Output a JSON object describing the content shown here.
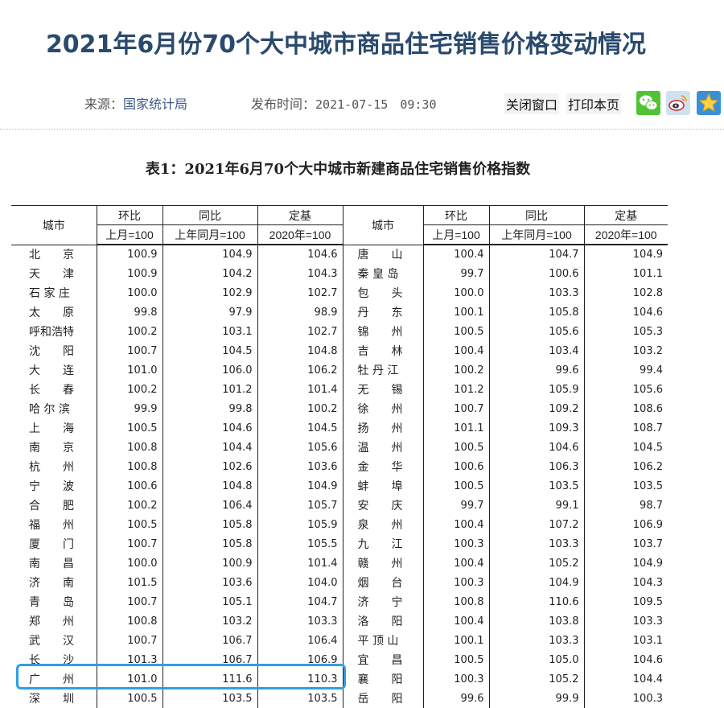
{
  "page": {
    "title": "2021年6月份70个大中城市商品住宅销售价格变动情况",
    "source_label": "来源：",
    "source_value": "国家统计局",
    "time_label": "发布时间：",
    "time_value": "2021-07-15　09:30",
    "close_window": "关闭窗口",
    "print_page": "打印本页",
    "share_icons": [
      "wechat-icon",
      "weibo-icon",
      "favorite-star-icon"
    ],
    "highlight_color": "#2e9fe8"
  },
  "table": {
    "caption": "表1：2021年6月70个大中城市新建商品住宅销售价格指数",
    "headers": {
      "city": "城市",
      "mom": "环比",
      "yoy": "同比",
      "base": "定基",
      "mom_base": "上月=100",
      "yoy_base": "上年同月=100",
      "base_base": "2020年=100"
    },
    "rows": [
      {
        "c1": "北　　京",
        "m1": "100.9",
        "y1": "104.9",
        "b1": "104.6",
        "c2": "唐　　山",
        "m2": "100.4",
        "y2": "104.7",
        "b2": "104.9"
      },
      {
        "c1": "天　　津",
        "m1": "100.9",
        "y1": "104.2",
        "b1": "104.3",
        "c2": "秦 皇 岛",
        "m2": "99.7",
        "y2": "100.6",
        "b2": "101.1"
      },
      {
        "c1": "石 家 庄",
        "m1": "100.0",
        "y1": "102.9",
        "b1": "102.7",
        "c2": "包　　头",
        "m2": "100.0",
        "y2": "103.3",
        "b2": "102.8"
      },
      {
        "c1": "太　　原",
        "m1": "99.8",
        "y1": "97.9",
        "b1": "98.9",
        "c2": "丹　　东",
        "m2": "100.1",
        "y2": "105.8",
        "b2": "104.6"
      },
      {
        "c1": "呼和浩特",
        "m1": "100.2",
        "y1": "103.1",
        "b1": "102.7",
        "c2": "锦　　州",
        "m2": "100.5",
        "y2": "105.6",
        "b2": "105.3"
      },
      {
        "c1": "沈　　阳",
        "m1": "100.7",
        "y1": "104.5",
        "b1": "104.8",
        "c2": "吉　　林",
        "m2": "100.4",
        "y2": "103.4",
        "b2": "103.2"
      },
      {
        "c1": "大　　连",
        "m1": "101.0",
        "y1": "106.0",
        "b1": "106.2",
        "c2": "牡 丹 江",
        "m2": "100.2",
        "y2": "99.6",
        "b2": "99.4"
      },
      {
        "c1": "长　　春",
        "m1": "100.2",
        "y1": "101.2",
        "b1": "101.4",
        "c2": "无　　锡",
        "m2": "101.2",
        "y2": "105.9",
        "b2": "105.6"
      },
      {
        "c1": "哈 尔 滨",
        "m1": "99.9",
        "y1": "99.8",
        "b1": "100.2",
        "c2": "徐　　州",
        "m2": "100.7",
        "y2": "109.2",
        "b2": "108.6"
      },
      {
        "c1": "上　　海",
        "m1": "100.5",
        "y1": "104.6",
        "b1": "104.5",
        "c2": "扬　　州",
        "m2": "101.1",
        "y2": "109.3",
        "b2": "108.7"
      },
      {
        "c1": "南　　京",
        "m1": "100.8",
        "y1": "104.4",
        "b1": "105.6",
        "c2": "温　　州",
        "m2": "100.5",
        "y2": "104.6",
        "b2": "104.5"
      },
      {
        "c1": "杭　　州",
        "m1": "100.8",
        "y1": "102.6",
        "b1": "103.6",
        "c2": "金　　华",
        "m2": "100.6",
        "y2": "106.3",
        "b2": "106.2"
      },
      {
        "c1": "宁　　波",
        "m1": "100.6",
        "y1": "104.8",
        "b1": "104.9",
        "c2": "蚌　　埠",
        "m2": "100.5",
        "y2": "103.5",
        "b2": "103.5"
      },
      {
        "c1": "合　　肥",
        "m1": "100.2",
        "y1": "106.4",
        "b1": "105.7",
        "c2": "安　　庆",
        "m2": "99.7",
        "y2": "99.1",
        "b2": "98.7"
      },
      {
        "c1": "福　　州",
        "m1": "100.5",
        "y1": "105.8",
        "b1": "105.9",
        "c2": "泉　　州",
        "m2": "100.4",
        "y2": "107.2",
        "b2": "106.9"
      },
      {
        "c1": "厦　　门",
        "m1": "100.7",
        "y1": "105.8",
        "b1": "105.5",
        "c2": "九　　江",
        "m2": "100.3",
        "y2": "103.3",
        "b2": "103.7"
      },
      {
        "c1": "南　　昌",
        "m1": "100.0",
        "y1": "100.9",
        "b1": "101.4",
        "c2": "赣　　州",
        "m2": "100.4",
        "y2": "105.2",
        "b2": "104.9"
      },
      {
        "c1": "济　　南",
        "m1": "101.5",
        "y1": "103.6",
        "b1": "104.0",
        "c2": "烟　　台",
        "m2": "100.3",
        "y2": "104.9",
        "b2": "104.3"
      },
      {
        "c1": "青　　岛",
        "m1": "100.7",
        "y1": "105.1",
        "b1": "104.7",
        "c2": "济　　宁",
        "m2": "100.8",
        "y2": "110.6",
        "b2": "109.5"
      },
      {
        "c1": "郑　　州",
        "m1": "100.8",
        "y1": "103.2",
        "b1": "103.3",
        "c2": "洛　　阳",
        "m2": "100.4",
        "y2": "103.8",
        "b2": "103.3"
      },
      {
        "c1": "武　　汉",
        "m1": "100.7",
        "y1": "106.7",
        "b1": "106.4",
        "c2": "平 顶 山",
        "m2": "100.1",
        "y2": "103.3",
        "b2": "103.1"
      },
      {
        "c1": "长　　沙",
        "m1": "101.3",
        "y1": "106.7",
        "b1": "106.9",
        "c2": "宜　　昌",
        "m2": "100.5",
        "y2": "105.0",
        "b2": "104.6"
      },
      {
        "c1": "广　　州",
        "m1": "101.0",
        "y1": "111.6",
        "b1": "110.3",
        "c2": "襄　　阳",
        "m2": "100.3",
        "y2": "105.2",
        "b2": "104.4"
      },
      {
        "c1": "深　　圳",
        "m1": "100.5",
        "y1": "103.5",
        "b1": "103.5",
        "c2": "岳　　阳",
        "m2": "99.6",
        "y2": "99.9",
        "b2": "100.3"
      }
    ]
  }
}
